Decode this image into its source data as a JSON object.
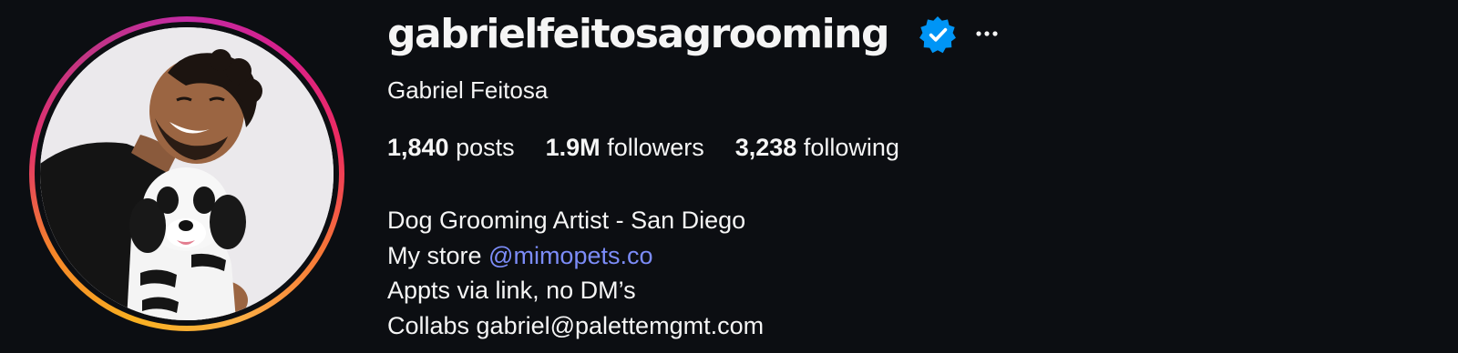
{
  "profile": {
    "username": "gabrielfeitosagrooming",
    "verified": true,
    "verified_icon": "verified-badge-icon",
    "more_icon": "more-options-icon",
    "full_name": "Gabriel Feitosa",
    "stats": {
      "posts_count": "1,840",
      "posts_label": "posts",
      "followers_count": "1.9M",
      "followers_label": "followers",
      "following_count": "3,238",
      "following_label": "following"
    },
    "bio": {
      "line1": "Dog Grooming Artist - San Diego",
      "line2_prefix": "My store",
      "line2_link": "@mimopets.co",
      "line3": "Appts via link, no DM’s",
      "line4": "Collabs gabriel@palettemgmt.com"
    }
  },
  "colors": {
    "background": "#0c0e12",
    "text": "#f5f5f5",
    "link": "#7c8cf8",
    "verified": "#0095f6"
  }
}
